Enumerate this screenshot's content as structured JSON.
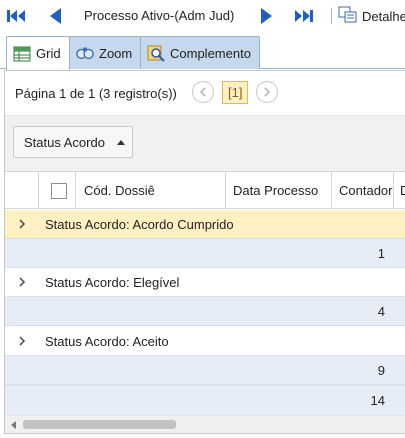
{
  "navbar": {
    "title": "Processo Ativo-(Adm Jud)",
    "detail_label": "Detalhe",
    "icons": [
      "first-record-icon",
      "previous-record-icon",
      "next-record-icon",
      "last-record-icon",
      "detail-icon"
    ],
    "accent_color": "#1f5fbf"
  },
  "tabs": [
    {
      "label": "Grid",
      "icon": "grid-icon",
      "active": true
    },
    {
      "label": "Zoom",
      "icon": "zoom-icon",
      "active": false
    },
    {
      "label": "Complemento",
      "icon": "complement-icon",
      "active": false
    }
  ],
  "pager": {
    "info": "Página 1 de 1 (3 registro(s))",
    "current_page": "[1]"
  },
  "group_panel": {
    "chip_label": "Status Acordo"
  },
  "columns": [
    "Cód. Dossiê",
    "Data Processo",
    "Contador",
    "D"
  ],
  "groups": [
    {
      "label": "Status Acordo: Acordo Cumprido",
      "count": "1",
      "highlighted": true
    },
    {
      "label": "Status Acordo: Elegível",
      "count": "4",
      "highlighted": false
    },
    {
      "label": "Status Acordo: Aceito",
      "count": "9",
      "highlighted": false
    }
  ],
  "total": "14",
  "colors": {
    "tab_bg": "#c6d8ee",
    "row_bg": "#e6edf6",
    "highlight_bg": "#fdf1c3",
    "page_bg": "#fdf0c6"
  }
}
